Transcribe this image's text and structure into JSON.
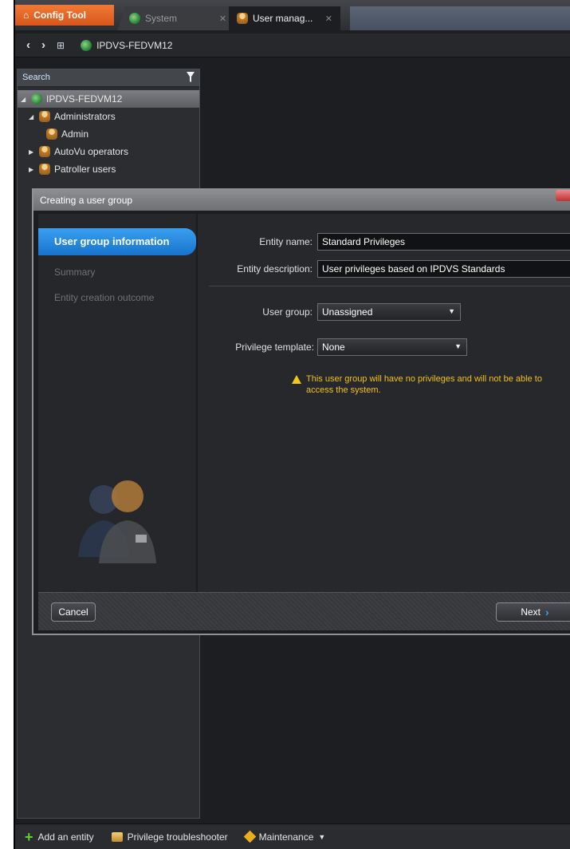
{
  "tabs": [
    {
      "label": "Config Tool",
      "icon": "home-icon"
    },
    {
      "label": "System",
      "icon": "globe-icon"
    },
    {
      "label": "User manag...",
      "icon": "user-icon"
    }
  ],
  "toolbar": {
    "server": "IPDVS-FEDVM12"
  },
  "tree": {
    "search_placeholder": "Search",
    "root": "IPDVS-FEDVM12",
    "items": [
      {
        "label": "Administrators"
      },
      {
        "label": "Admin"
      },
      {
        "label": "AutoVu operators"
      },
      {
        "label": "Patroller users"
      }
    ]
  },
  "dialog": {
    "title": "Creating a user group",
    "steps": [
      "User group information",
      "Summary",
      "Entity creation outcome"
    ],
    "entity_name_label": "Entity name:",
    "entity_name": "Standard Privileges",
    "entity_description_label": "Entity description:",
    "entity_description": "User privileges based on IPDVS Standards",
    "user_group_label": "User group:",
    "user_group_value": "Unassigned",
    "privilege_template_label": "Privilege template:",
    "privilege_template_value": "None",
    "warning": "This user group will have no privileges and will not be able to access the system.",
    "cancel": "Cancel",
    "next": "Next"
  },
  "bottom": {
    "add_entity": "Add an entity",
    "privilege_troubleshooter": "Privilege troubleshooter",
    "maintenance": "Maintenance"
  },
  "colors": {
    "accent": "#1873cc",
    "warning": "#f0c020",
    "tab_active": "#d8561a"
  }
}
